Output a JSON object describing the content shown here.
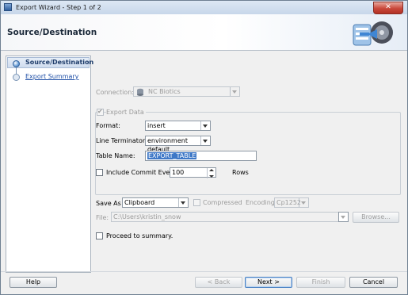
{
  "window": {
    "title": "Export Wizard - Step 1 of 2",
    "close_label": "✕"
  },
  "header": {
    "title": "Source/Destination"
  },
  "steps": [
    {
      "label": "Source/Destination"
    },
    {
      "label": "Export Summary"
    }
  ],
  "connection": {
    "label": "Connection:",
    "value": "NC Biotics"
  },
  "export_data": {
    "label": "Export Data",
    "checked": true
  },
  "format": {
    "label": "Format:",
    "value": "insert"
  },
  "line_terminator": {
    "label": "Line Terminator:",
    "value": "environment default"
  },
  "table_name": {
    "label": "Table Name:",
    "value": "EXPORT_TABLE"
  },
  "commit": {
    "label": "Include Commit Every",
    "value": "100",
    "unit": "Rows",
    "checked": false
  },
  "save_as": {
    "label": "Save As",
    "value": "Clipboard"
  },
  "compressed": {
    "label": "Compressed",
    "checked": false
  },
  "encoding": {
    "label": "Encoding:",
    "value": "Cp1252"
  },
  "file": {
    "label": "File:",
    "value": "C:\\Users\\kristin_snow",
    "browse_label": "Browse..."
  },
  "proceed": {
    "label": "Proceed to summary.",
    "checked": false
  },
  "footer": {
    "help_label": "Help",
    "back_label": "< Back",
    "next_label": "Next >",
    "finish_label": "Finish",
    "cancel_label": "Cancel"
  }
}
